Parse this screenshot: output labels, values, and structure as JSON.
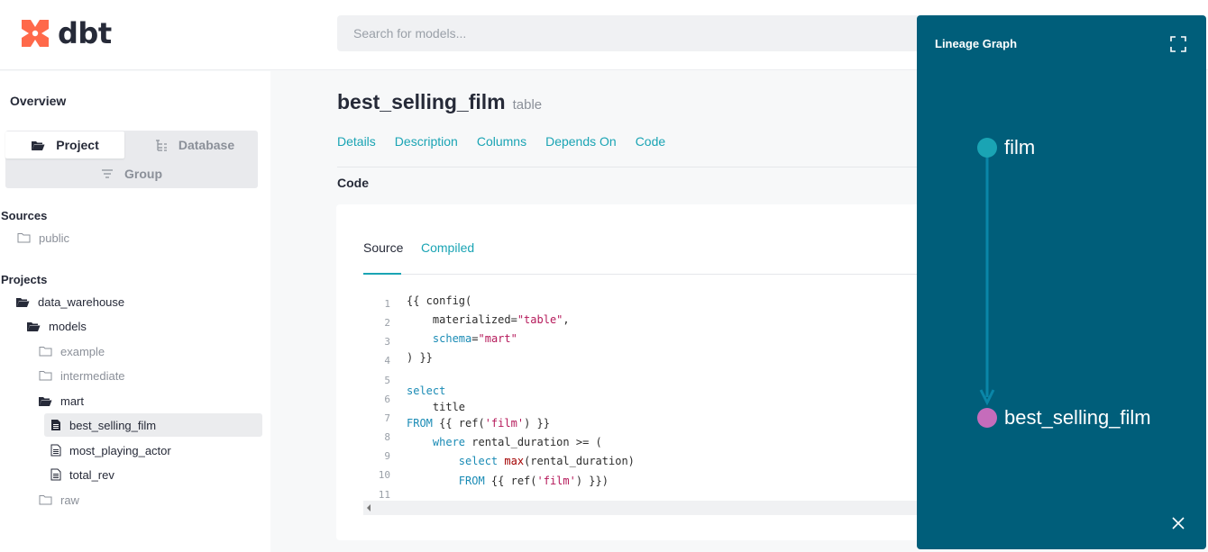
{
  "app": {
    "logo_text": "dbt"
  },
  "search": {
    "placeholder": "Search for models..."
  },
  "sidebar": {
    "overview": "Overview",
    "toggle": {
      "project": "Project",
      "database": "Database",
      "group": "Group"
    },
    "sources_title": "Sources",
    "sources": [
      {
        "label": "public"
      }
    ],
    "projects_title": "Projects",
    "tree": [
      {
        "label": "data_warehouse"
      },
      {
        "label": "models"
      },
      {
        "label": "example"
      },
      {
        "label": "intermediate"
      },
      {
        "label": "mart"
      },
      {
        "label": "best_selling_film"
      },
      {
        "label": "most_playing_actor"
      },
      {
        "label": "total_rev"
      },
      {
        "label": "raw"
      }
    ]
  },
  "model": {
    "name": "best_selling_film",
    "type": "table",
    "tabs": [
      "Details",
      "Description",
      "Columns",
      "Depends On",
      "Code"
    ],
    "code_heading": "Code",
    "code_tabs": {
      "source": "Source",
      "compiled": "Compiled"
    },
    "line_numbers": [
      "1",
      "2",
      "3",
      "4",
      "5",
      "6",
      "7",
      "8",
      "9",
      "10",
      "11"
    ]
  },
  "lineage": {
    "title": "Lineage Graph",
    "nodes": [
      {
        "label": "film",
        "color": "#1aa4b4"
      },
      {
        "label": "best_selling_film",
        "color": "#c56cbb"
      }
    ]
  },
  "colors": {
    "accent": "#1aa4b4",
    "lineage_bg": "#005e7a",
    "brand": "#ff694a"
  }
}
